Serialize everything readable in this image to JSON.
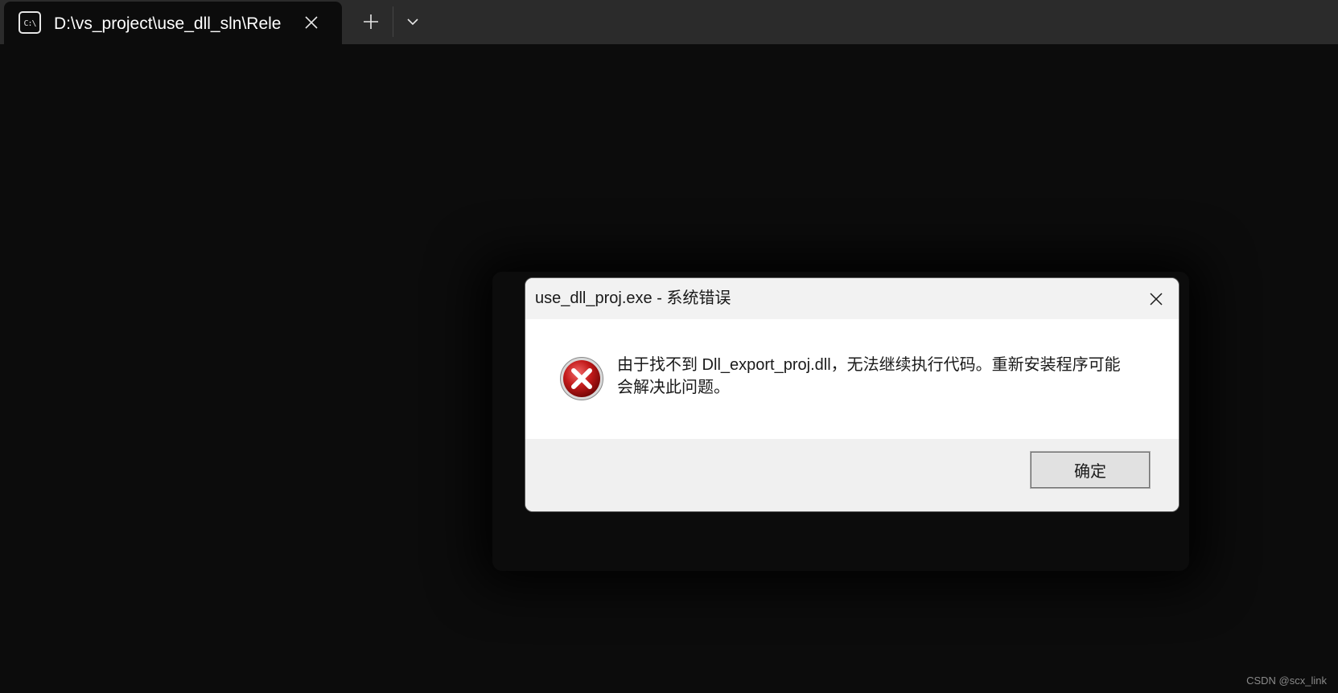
{
  "terminal": {
    "tab": {
      "title": "D:\\vs_project\\use_dll_sln\\Rele",
      "icon_text": "C:\\"
    },
    "new_tab_icon": "plus-icon",
    "dropdown_icon": "chevron-down-icon"
  },
  "dialog": {
    "title": "use_dll_proj.exe - 系统错误",
    "message_line1": "由于找不到 Dll_export_proj.dll，无法继续执行代码。重新安装程序可能",
    "message_line2": "会解决此问题。",
    "ok_label": "确定",
    "icon": "error-icon"
  },
  "watermark": "CSDN @scx_link",
  "colors": {
    "terminal_bg": "#0c0c0c",
    "tabbar_bg": "#2b2b2b",
    "error_red": "#c21a1a"
  }
}
